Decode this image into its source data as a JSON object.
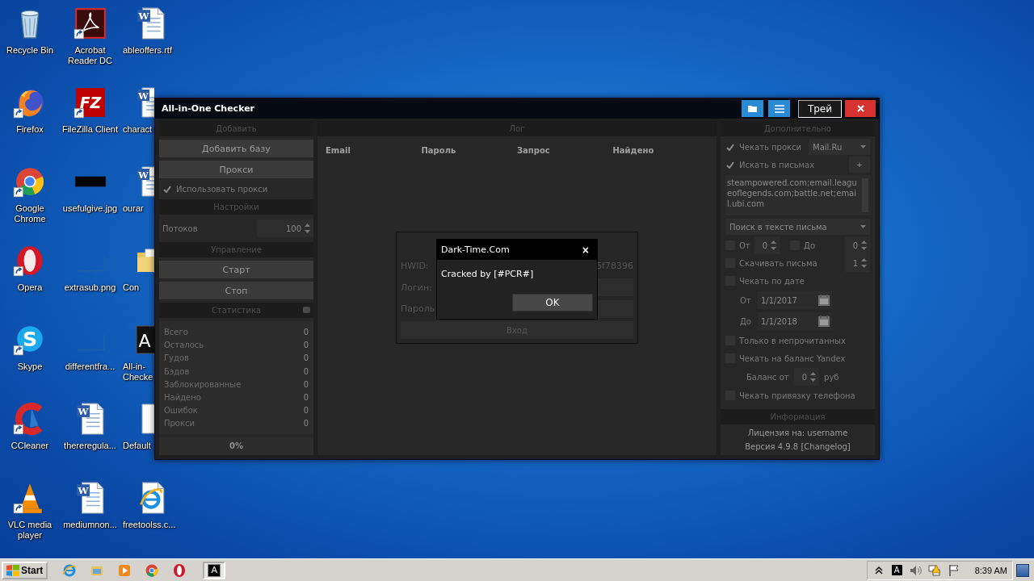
{
  "desktop": {
    "columns": [
      {
        "icons": [
          {
            "label": "Recycle Bin",
            "kind": "recycle",
            "shortcut": false
          },
          {
            "label": "Firefox",
            "kind": "firefox",
            "shortcut": true
          },
          {
            "label": "Google Chrome",
            "kind": "chrome",
            "shortcut": true
          },
          {
            "label": "Opera",
            "kind": "opera",
            "shortcut": true
          },
          {
            "label": "Skype",
            "kind": "skype",
            "glyph": "S",
            "shortcut": true
          },
          {
            "label": "CCleaner",
            "kind": "ccleaner",
            "shortcut": true
          },
          {
            "label": "VLC media player",
            "kind": "vlc",
            "shortcut": true
          }
        ]
      },
      {
        "icons": [
          {
            "label": "Acrobat Reader DC",
            "kind": "acrobat",
            "shortcut": true
          },
          {
            "label": "FileZilla Client",
            "kind": "filezilla",
            "glyph": "FZ",
            "shortcut": true
          },
          {
            "label": "usefulgive.jpg",
            "kind": "image-dark",
            "shortcut": false
          },
          {
            "label": "extrasub.png",
            "kind": "image-blank",
            "shortcut": false
          },
          {
            "label": "differentfra...",
            "kind": "image-blank",
            "shortcut": false
          },
          {
            "label": "thereregula...",
            "kind": "word",
            "glyph": "W",
            "shortcut": false
          },
          {
            "label": "mediumnon...",
            "kind": "word",
            "glyph": "W",
            "shortcut": false
          }
        ]
      },
      {
        "icons": [
          {
            "label": "ableoffers.rtf",
            "kind": "word",
            "glyph": "W",
            "shortcut": false
          },
          {
            "label": "charact",
            "kind": "word",
            "glyph": "W",
            "shortcut": false
          },
          {
            "label": "ourar",
            "kind": "word",
            "glyph": "W",
            "shortcut": false
          },
          {
            "label": "Con",
            "kind": "folder",
            "shortcut": false
          },
          {
            "label": "All-in-\nChecke",
            "kind": "app",
            "glyph": "A",
            "shortcut": false
          },
          {
            "label": "Default",
            "kind": "blank-doc",
            "shortcut": false
          },
          {
            "label": "freetoolss.c...",
            "kind": "ie-doc",
            "shortcut": false
          }
        ]
      }
    ]
  },
  "window": {
    "title": "All-in-One Checker",
    "title_buttons": [
      {
        "kind": "folder"
      },
      {
        "kind": "menu"
      },
      {
        "kind": "tray",
        "label": "Трей"
      },
      {
        "kind": "close"
      }
    ]
  },
  "left_panel": {
    "add_header": "Добавить",
    "add_base_button": "Добавить базу",
    "proxy_button": "Прокси",
    "use_proxy": {
      "label": "Использовать прокси",
      "checked": true
    },
    "settings_header": "Настройки",
    "threads": {
      "label": "Потоков",
      "value": "100"
    },
    "control_header": "Управление",
    "start_button": "Старт",
    "stop_button": "Стоп",
    "stats_header": "Статистика",
    "stats": [
      {
        "label": "Всего",
        "value": "0"
      },
      {
        "label": "Осталось",
        "value": "0"
      },
      {
        "label": "Гудов",
        "value": "0"
      },
      {
        "label": "Бэдов",
        "value": "0"
      },
      {
        "label": "Заблокированные",
        "value": "0"
      },
      {
        "label": "Найдено",
        "value": "0"
      },
      {
        "label": "Ошибок",
        "value": "0"
      },
      {
        "label": "Прокси",
        "value": "0"
      }
    ],
    "progress": "0%"
  },
  "log_panel": {
    "header": "Лог",
    "columns": [
      "Email",
      "Пароль",
      "Запрос",
      "Найдено"
    ],
    "login": {
      "hwid_label": "HWID:",
      "hwid_value": "5f78396",
      "login_label": "Логин:",
      "password_label": "Пароль:",
      "login_button": "Вход"
    }
  },
  "dialog": {
    "title": "Dark-Time.Com",
    "close": "×",
    "message": "Cracked by [#PCR#]",
    "ok_button": "OK"
  },
  "right_panel": {
    "header": "Дополнительно",
    "check_proxy": {
      "label": "Чекать прокси",
      "checked": true,
      "service": "Mail.Ru"
    },
    "search_letters": {
      "label": "Искать в письмах",
      "checked": true,
      "add": "+"
    },
    "domains": "steampowered.com;email.leagueoflegends.com;battle.net;email.ubi.com",
    "search_mode": "Поиск в тексте письма",
    "from": {
      "label": "От",
      "checked": false,
      "value": "0"
    },
    "to": {
      "label": "До",
      "checked": false,
      "value": "0"
    },
    "download": {
      "label": "Скачивать письма",
      "checked": false,
      "value": "1"
    },
    "by_date": {
      "label": "Чекать по дате",
      "checked": false
    },
    "date_from": {
      "label": "От",
      "value": "1/1/2017"
    },
    "date_to": {
      "label": "До",
      "value": "1/1/2018"
    },
    "unread_only": {
      "label": "Только в непрочитанных",
      "checked": false
    },
    "yandex_balance": {
      "label": "Чекать на баланс Yandex",
      "checked": false
    },
    "balance": {
      "label": "Баланс от",
      "value": "0",
      "unit": "руб"
    },
    "phone_binding": {
      "label": "Чекать привязку телефона",
      "checked": false
    },
    "info_header": "Информация",
    "license": "Лицензия на: username",
    "version": "Версия 4.9.8 [Changelog]"
  },
  "taskbar": {
    "start": "Start",
    "quick_launch": [
      {
        "kind": "ie",
        "selected": false
      },
      {
        "kind": "explorer",
        "selected": false
      },
      {
        "kind": "media",
        "selected": false
      },
      {
        "kind": "chrome",
        "selected": false
      },
      {
        "kind": "opera",
        "selected": false
      },
      {
        "kind": "app",
        "glyph": "A",
        "selected": true
      }
    ],
    "tray": [
      {
        "kind": "chevron"
      },
      {
        "kind": "app",
        "glyph": "A"
      },
      {
        "kind": "speaker"
      },
      {
        "kind": "network"
      },
      {
        "kind": "flag"
      }
    ],
    "clock": "8:39 AM"
  }
}
